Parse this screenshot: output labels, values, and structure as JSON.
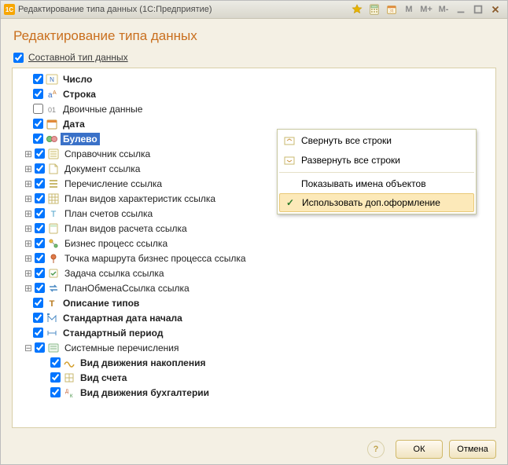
{
  "window": {
    "app_badge": "1C",
    "title": "Редактирование типа данных  (1С:Предприятие)"
  },
  "toolbar_text": {
    "m": "M",
    "m_plus": "M+",
    "m_minus": "M-"
  },
  "page": {
    "heading": "Редактирование типа данных"
  },
  "composite": {
    "label": "Составной тип данных",
    "checked": true
  },
  "tree": [
    {
      "id": "number",
      "label": "Число",
      "bold": true,
      "checked": true,
      "level": 1
    },
    {
      "id": "string",
      "label": "Строка",
      "bold": true,
      "checked": true,
      "level": 1
    },
    {
      "id": "binary",
      "label": "Двоичные данные",
      "bold": false,
      "checked": false,
      "level": 1
    },
    {
      "id": "date",
      "label": "Дата",
      "bold": true,
      "checked": true,
      "level": 1
    },
    {
      "id": "bool",
      "label": "Булево",
      "bold": true,
      "checked": true,
      "level": 1,
      "selected": true
    },
    {
      "id": "catalog",
      "label": "Справочник ссылка",
      "checked": true,
      "level": 1,
      "expander": "+"
    },
    {
      "id": "doc",
      "label": "Документ ссылка",
      "checked": true,
      "level": 1,
      "expander": "+"
    },
    {
      "id": "enum",
      "label": "Перечисление ссылка",
      "checked": true,
      "level": 1,
      "expander": "+"
    },
    {
      "id": "pvc",
      "label": "План видов характеристик ссылка",
      "checked": true,
      "level": 1,
      "expander": "+"
    },
    {
      "id": "accplan",
      "label": "План счетов ссылка",
      "checked": true,
      "level": 1,
      "expander": "+"
    },
    {
      "id": "pvr",
      "label": "План видов расчета ссылка",
      "checked": true,
      "level": 1,
      "expander": "+"
    },
    {
      "id": "bp",
      "label": "Бизнес процесс ссылка",
      "checked": true,
      "level": 1,
      "expander": "+"
    },
    {
      "id": "route",
      "label": "Точка маршрута бизнес процесса ссылка",
      "checked": true,
      "level": 1,
      "expander": "+"
    },
    {
      "id": "task",
      "label": "Задача ссылка ссылка",
      "checked": true,
      "level": 1,
      "expander": "+"
    },
    {
      "id": "exch",
      "label": "ПланОбменаСсылка ссылка",
      "checked": true,
      "level": 1,
      "expander": "+"
    },
    {
      "id": "tdesc",
      "label": "Описание типов",
      "bold": true,
      "checked": true,
      "level": 1
    },
    {
      "id": "stddate",
      "label": "Стандартная дата начала",
      "bold": true,
      "checked": true,
      "level": 1
    },
    {
      "id": "stdper",
      "label": "Стандартный период",
      "bold": true,
      "checked": true,
      "level": 1
    },
    {
      "id": "sysenum",
      "label": "Системные перечисления",
      "checked": true,
      "level": 1,
      "expander": "−"
    },
    {
      "id": "movkind",
      "label": "Вид движения накопления",
      "bold": true,
      "checked": true,
      "level": 2
    },
    {
      "id": "acckind",
      "label": "Вид счета",
      "bold": true,
      "checked": true,
      "level": 2
    },
    {
      "id": "buhkind",
      "label": "Вид движения бухгалтерии",
      "bold": true,
      "checked": true,
      "level": 2
    }
  ],
  "icons": {
    "number": "num",
    "string": "str",
    "binary": "bin",
    "date": "cal",
    "bool": "bool",
    "catalog": "ref",
    "doc": "doc",
    "enum": "enum",
    "pvc": "grid",
    "accplan": "t",
    "pvr": "calc",
    "bp": "flow",
    "route": "pin",
    "task": "task",
    "exch": "exch",
    "tdesc": "tdesc",
    "stddate": "sdate",
    "stdper": "sper",
    "sysenum": "sys",
    "movkind": "wave",
    "acckind": "acc",
    "buhkind": "dk"
  },
  "context_menu": {
    "items": [
      {
        "id": "collapse",
        "label": "Свернуть все строки",
        "icon": "collapse"
      },
      {
        "id": "expand",
        "label": "Развернуть все строки",
        "icon": "expand",
        "sep_after": true
      },
      {
        "id": "shownames",
        "label": "Показывать имена объектов"
      },
      {
        "id": "useextra",
        "label": "Использовать доп.оформление",
        "checked": true,
        "highlight": true
      }
    ]
  },
  "footer": {
    "help": "?",
    "ok": "ОК",
    "cancel": "Отмена"
  }
}
